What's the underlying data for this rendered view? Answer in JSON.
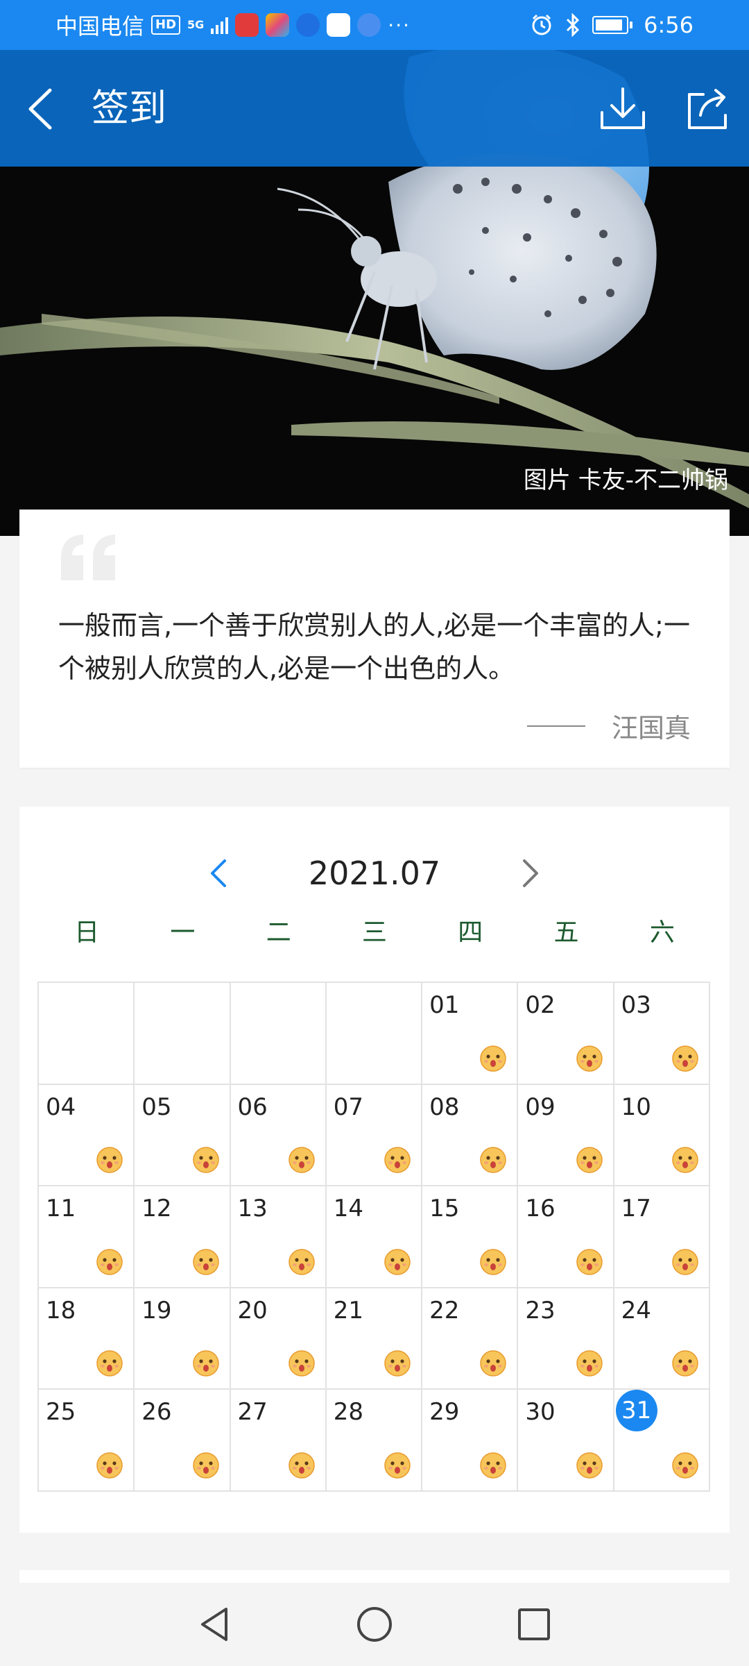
{
  "status_bar": {
    "carrier": "中国电信",
    "hd_badge": "HD",
    "network": "5G",
    "more": "···",
    "time": "6:56",
    "battery_level": 0.9
  },
  "header": {
    "title": "签到"
  },
  "hero": {
    "credit": "图片 卡友-不二帅锅"
  },
  "quote": {
    "text": "一般而言,一个善于欣赏别人的人,必是一个丰富的人;一个被别人欣赏的人,必是一个出色的人。",
    "author": "汪国真"
  },
  "calendar": {
    "month": "2021.07",
    "weekdays": [
      "日",
      "一",
      "二",
      "三",
      "四",
      "五",
      "六"
    ],
    "leading_blanks": 4,
    "days": [
      "01",
      "02",
      "03",
      "04",
      "05",
      "06",
      "07",
      "08",
      "09",
      "10",
      "11",
      "12",
      "13",
      "14",
      "15",
      "16",
      "17",
      "18",
      "19",
      "20",
      "21",
      "22",
      "23",
      "24",
      "25",
      "26",
      "27",
      "28",
      "29",
      "30",
      "31"
    ],
    "today": "31"
  },
  "colors": {
    "accent": "#1a88f0",
    "header": "#0a6cc8",
    "weekday": "#1c5a2e"
  },
  "icons": {
    "back": "chevron-left-icon",
    "download": "download-icon",
    "share": "share-icon",
    "checkin": "smiley-face-icon"
  }
}
